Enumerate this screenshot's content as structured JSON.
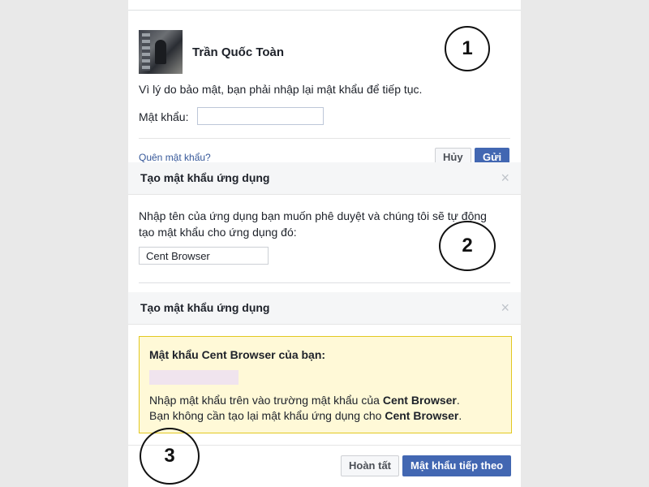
{
  "reauth": {
    "user_name": "Trần Quốc Toàn",
    "reason_text": "Vì lý do bảo mật, bạn phải nhập lại mật khẩu để tiếp tục.",
    "password_label": "Mật khẩu:",
    "password_value": "",
    "forgot_link": "Quên mật khẩu?",
    "cancel_label": "Hủy",
    "send_label": "Gửi"
  },
  "create_app_password": {
    "title": "Tạo mật khẩu ứng dụng",
    "close_icon": "×",
    "description": "Nhập tên của ứng dụng bạn muốn phê duyệt và chúng tôi sẽ tự động tạo mật khẩu cho ứng dụng đó:",
    "app_name_value": "Cent Browser"
  },
  "result_dialog": {
    "title": "Tạo mật khẩu ứng dụng",
    "close_icon": "×",
    "notice_title": "Mật khẩu Cent Browser của bạn:",
    "line1_prefix": "Nhập mật khẩu trên vào trường mật khẩu của ",
    "line1_app": "Cent Browser",
    "line1_suffix": ".",
    "line2_prefix": "Bạn không cần tạo lại mật khẩu ứng dụng cho ",
    "line2_app": "Cent Browser",
    "line2_suffix": ".",
    "done_label": "Hoàn tất",
    "next_label": "Mật khẩu tiếp theo"
  },
  "steps": {
    "one": "1",
    "two": "2",
    "three": "3"
  },
  "colors": {
    "primary_button": "#4267b2",
    "link": "#365899",
    "notice_bg": "#fff9d7",
    "notice_border": "#e2c822"
  }
}
